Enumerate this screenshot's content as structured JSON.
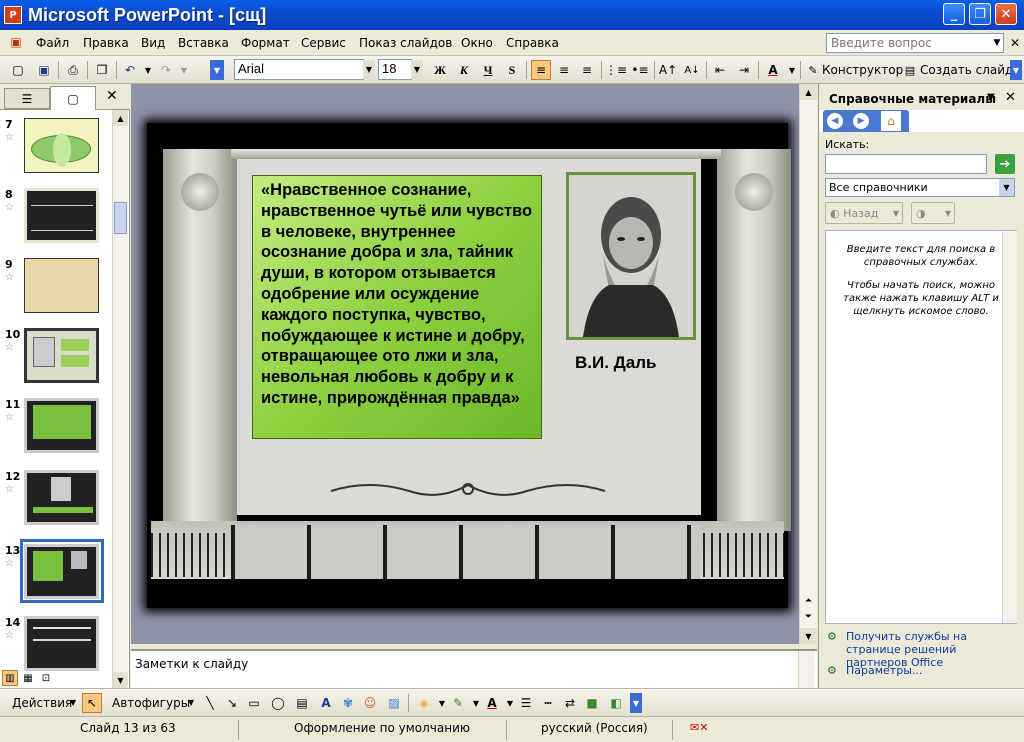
{
  "window": {
    "title": "Microsoft PowerPoint - [сщ]",
    "app_icon_letter": "P"
  },
  "menu": [
    "Файл",
    "Правка",
    "Вид",
    "Вставка",
    "Формат",
    "Сервис",
    "Показ слайдов",
    "Окно",
    "Справка"
  ],
  "ask_question": {
    "placeholder": "Введите вопрос"
  },
  "toolbar": {
    "font_name": "Arial",
    "font_size": "18",
    "bold": "Ж",
    "italic": "К",
    "underline": "Ч",
    "shadow": "S",
    "designer": "Конструктор",
    "new_slide": "Создать слайд"
  },
  "slides": [
    {
      "num": "7"
    },
    {
      "num": "8"
    },
    {
      "num": "9"
    },
    {
      "num": "10"
    },
    {
      "num": "11"
    },
    {
      "num": "12"
    },
    {
      "num": "13"
    },
    {
      "num": "14"
    }
  ],
  "slide": {
    "quote": "«Нравственное сознание, нравственное чутьё или чувство в человеке, внутреннее осознание добра и зла, тайник души, в котором отзывается одобрение или осуждение каждого поступка, чувство, побуждающее к истине и добру, отвращающее ото лжи и зла, невольная любовь к добру и к истине, прирождённая правда»",
    "author": "В.И. Даль"
  },
  "notes": {
    "placeholder": "Заметки к слайду"
  },
  "taskpane": {
    "title": "Справочные материалы",
    "search_label": "Искать:",
    "search_value": "",
    "source": "Все справочники",
    "back": "Назад",
    "hint1": "Введите текст для поиска в справочных службах.",
    "hint2": "Чтобы начать поиск, можно также нажать клавишу ALT и щелкнуть искомое слово.",
    "link1": "Получить службы на странице решений партнеров Office",
    "link2": "Параметры..."
  },
  "drawbar": {
    "actions": "Действия",
    "autoshapes": "Автофигуры"
  },
  "status": {
    "slide": "Слайд 13 из 63",
    "design": "Оформление по умолчанию",
    "language": "русский (Россия)"
  }
}
